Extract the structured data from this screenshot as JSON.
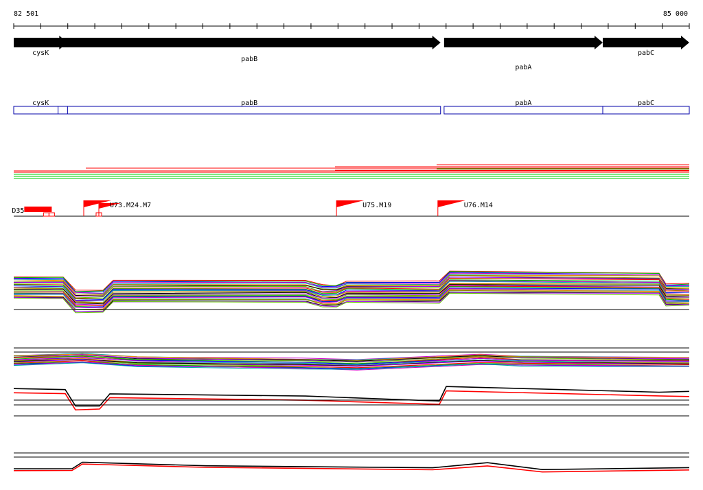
{
  "ruler": {
    "start_label": "82 501",
    "end_label": "85 000"
  },
  "genes": [
    {
      "name": "cysK",
      "start": 82501,
      "end": 82700,
      "strand": "+"
    },
    {
      "name": "pabB",
      "start": 82665,
      "end": 84080,
      "strand": "+"
    },
    {
      "name": "pabA",
      "start": 84093,
      "end": 84680,
      "strand": "+"
    },
    {
      "name": "pabC",
      "start": 84680,
      "end": 85000,
      "strand": "+"
    }
  ],
  "features": [
    {
      "name": "cysK",
      "start": 82501,
      "end": 82700
    },
    {
      "name": "pabB",
      "start": 82665,
      "end": 84080
    },
    {
      "name": "pabA",
      "start": 84093,
      "end": 84680
    },
    {
      "name": "pabC",
      "start": 84680,
      "end": 85000
    }
  ],
  "markers": [
    {
      "label": "D35",
      "position": 82540,
      "kind": "deletion",
      "end": 82690
    },
    {
      "label": "U73.M24.M7",
      "position": 82760,
      "kind": "insertion"
    },
    {
      "label": "U75.M19",
      "position": 83695,
      "kind": "insertion"
    },
    {
      "label": "U76.M14",
      "position": 84070,
      "kind": "insertion"
    }
  ],
  "colors": {
    "gene": "#000000",
    "feature_box": "#0000aa",
    "marker": "#ff0000",
    "axis": "#000000",
    "palette": [
      "#ff0000",
      "#00bb00",
      "#0000ff",
      "#cc00cc",
      "#00aaaa",
      "#ff8800",
      "#888800",
      "#000000",
      "#aa00ff",
      "#66cc00"
    ]
  }
}
